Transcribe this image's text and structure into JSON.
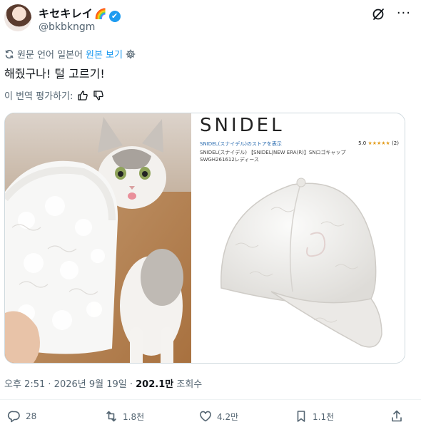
{
  "author": {
    "name": "キセキレイ",
    "name_emoji": "🌈",
    "verified_mark": "✔",
    "handle": "@bkbkngm"
  },
  "translation": {
    "original_language_label": "원문 언어 일본어",
    "view_original_link": "원본 보기",
    "rate_label": "이 번역 평가하기:"
  },
  "post": {
    "text": "해줬구나! 털 고르기!"
  },
  "media": {
    "right_image": {
      "brand": "SNIDEL",
      "store_line": "SNIDEL(スナイデル)のストアを表示",
      "rating": "5.0",
      "stars": "★★★★★",
      "rating_count": "(2)",
      "product_line1": "SNIDEL(スナイデル) 【SNIDEL|NEW ERA(R)】SNロゴキャップ",
      "product_line2": "SWGH261612レディース"
    }
  },
  "meta": {
    "time": "오후 2:51",
    "separator": "·",
    "date": "2026년 9월 19일",
    "views_count": "202.1만",
    "views_label": "조회수"
  },
  "actions": {
    "replies": "28",
    "reposts": "1.8천",
    "likes": "4.2만",
    "bookmarks": "1.1천"
  },
  "icons": {
    "translate": "translate-icon",
    "settings": "gear-icon",
    "thumbs_up": "thumbs-up-icon",
    "thumbs_down": "thumbs-down-icon",
    "grok": "grok-icon",
    "more": "more-icon",
    "reply": "reply-icon",
    "repost": "repost-icon",
    "like": "heart-icon",
    "bookmark": "bookmark-icon",
    "share": "share-icon"
  },
  "colors": {
    "accent": "#1d9bf0",
    "text": "#0f1419",
    "secondary": "#536471"
  }
}
